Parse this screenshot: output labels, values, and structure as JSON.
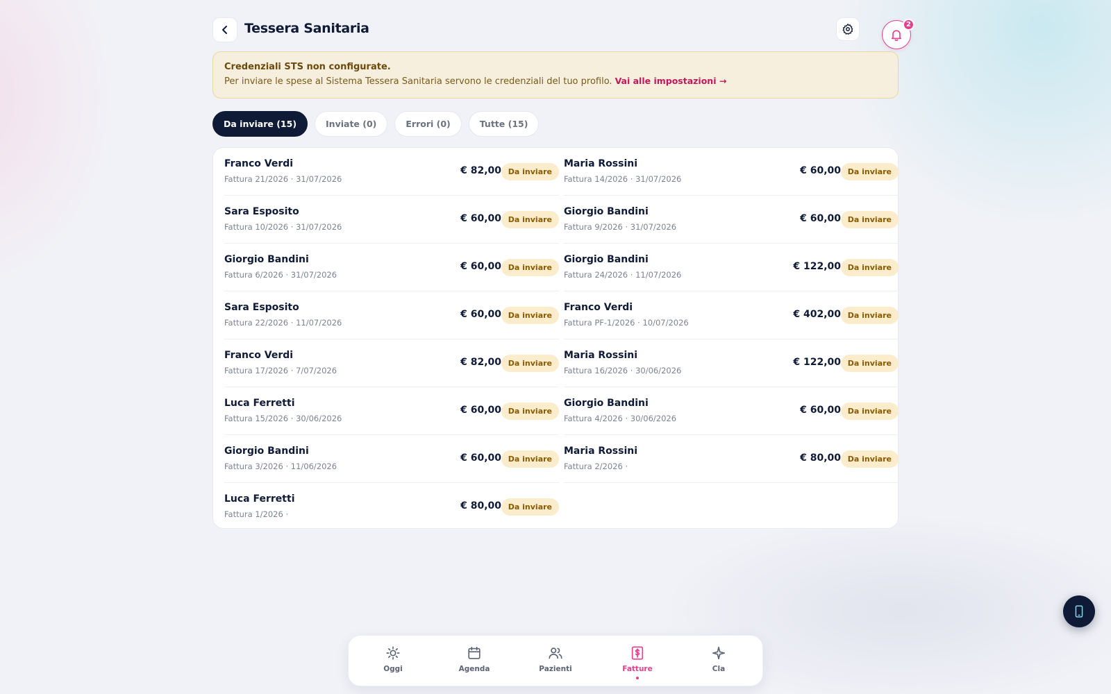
{
  "header": {
    "title": "Tessera Sanitaria",
    "notification_count": "2"
  },
  "alert": {
    "title": "Credenziali STS non configurate.",
    "text": "Per inviare le spese al Sistema Tessera Sanitaria servono le credenziali del tuo profilo.",
    "link": "Vai alle impostazioni →"
  },
  "tabs": [
    {
      "label": "Da inviare (15)",
      "active": true
    },
    {
      "label": "Inviate (0)"
    },
    {
      "label": "Errori (0)"
    },
    {
      "label": "Tutte (15)"
    }
  ],
  "invoices_left": [
    {
      "patient": "Franco Verdi",
      "sub": "Fattura 21/2026 · 31/07/2026",
      "amount": "€ 82,00",
      "status": "Da inviare"
    },
    {
      "patient": "Sara Esposito",
      "sub": "Fattura 10/2026 · 31/07/2026",
      "amount": "€ 60,00",
      "status": "Da inviare"
    },
    {
      "patient": "Giorgio Bandini",
      "sub": "Fattura 6/2026 · 31/07/2026",
      "amount": "€ 60,00",
      "status": "Da inviare"
    },
    {
      "patient": "Sara Esposito",
      "sub": "Fattura 22/2026 · 11/07/2026",
      "amount": "€ 60,00",
      "status": "Da inviare"
    },
    {
      "patient": "Franco Verdi",
      "sub": "Fattura 17/2026 · 7/07/2026",
      "amount": "€ 82,00",
      "status": "Da inviare"
    },
    {
      "patient": "Luca Ferretti",
      "sub": "Fattura 15/2026 · 30/06/2026",
      "amount": "€ 60,00",
      "status": "Da inviare"
    },
    {
      "patient": "Giorgio Bandini",
      "sub": "Fattura 3/2026 · 11/06/2026",
      "amount": "€ 60,00",
      "status": "Da inviare"
    },
    {
      "patient": "Luca Ferretti",
      "sub": "Fattura 1/2026 ·",
      "amount": "€ 80,00",
      "status": "Da inviare"
    }
  ],
  "invoices_right": [
    {
      "patient": "Maria Rossini",
      "sub": "Fattura 14/2026 · 31/07/2026",
      "amount": "€ 60,00",
      "status": "Da inviare"
    },
    {
      "patient": "Giorgio Bandini",
      "sub": "Fattura 9/2026 · 31/07/2026",
      "amount": "€ 60,00",
      "status": "Da inviare"
    },
    {
      "patient": "Giorgio Bandini",
      "sub": "Fattura 24/2026 · 11/07/2026",
      "amount": "€ 122,00",
      "status": "Da inviare"
    },
    {
      "patient": "Franco Verdi",
      "sub": "Fattura PF-1/2026 · 10/07/2026",
      "amount": "€ 402,00",
      "status": "Da inviare"
    },
    {
      "patient": "Maria Rossini",
      "sub": "Fattura 16/2026 · 30/06/2026",
      "amount": "€ 122,00",
      "status": "Da inviare"
    },
    {
      "patient": "Giorgio Bandini",
      "sub": "Fattura 4/2026 · 30/06/2026",
      "amount": "€ 60,00",
      "status": "Da inviare"
    },
    {
      "patient": "Maria Rossini",
      "sub": "Fattura 2/2026 ·",
      "amount": "€ 80,00",
      "status": "Da inviare"
    }
  ],
  "bottom_nav": [
    {
      "label": "Oggi",
      "icon": "sun-icon"
    },
    {
      "label": "Agenda",
      "icon": "calendar-icon"
    },
    {
      "label": "Pazienti",
      "icon": "users-icon"
    },
    {
      "label": "Fatture",
      "icon": "invoice-icon",
      "active": true
    },
    {
      "label": "Cla",
      "icon": "sparkle-icon"
    }
  ],
  "colors": {
    "accent": "#e83e8c",
    "navy": "#0f1a36",
    "warning_bg": "#f6efdd",
    "badge_bg": "#fbeccc"
  }
}
